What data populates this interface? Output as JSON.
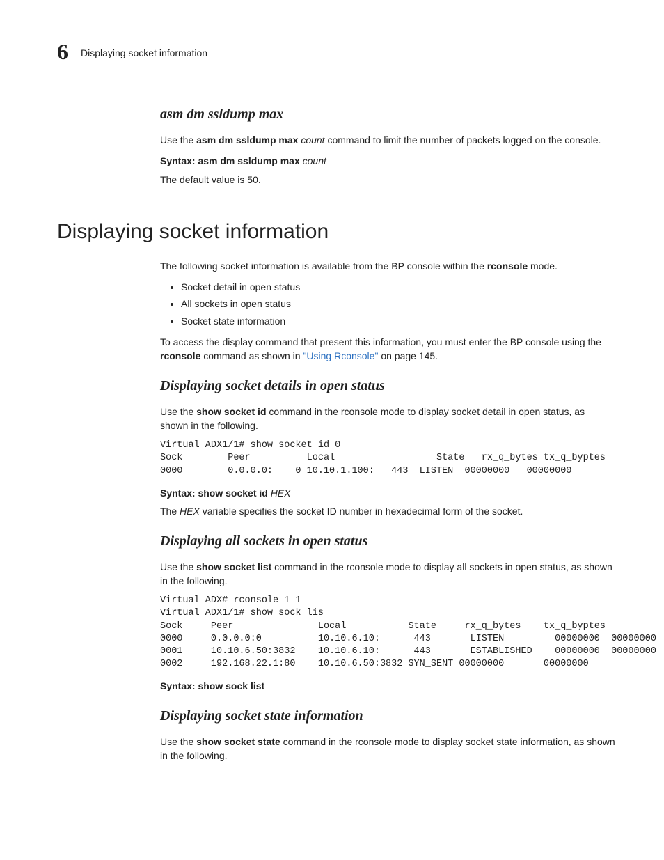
{
  "running_head": {
    "chapter_number": "6",
    "chapter_title": "Displaying socket information"
  },
  "sec_ssldump": {
    "heading": "asm dm ssldump max",
    "p1_a": "Use the ",
    "p1_cmd": "asm dm ssldump max",
    "p1_b": " ",
    "p1_arg": "count",
    "p1_c": " command to limit the number of packets logged on the console.",
    "syntax_label": "Syntax:",
    "syntax_cmd": "asm dm ssldump max",
    "syntax_arg": "count",
    "p2": "The default value is 50."
  },
  "h_main": "Displaying socket information",
  "sec_intro": {
    "p1_a": "The following socket information is available from the BP console within the ",
    "p1_b": "rconsole",
    "p1_c": " mode.",
    "bullets": [
      "Socket detail in open status",
      "All sockets in open status",
      "Socket state information"
    ],
    "p2_a": "To access the display command that present this information, you must enter the BP console using the ",
    "p2_b": "rconsole",
    "p2_c": " command as shown in ",
    "p2_link": "\"Using Rconsole\"",
    "p2_d": " on page 145."
  },
  "sec_detail": {
    "heading": "Displaying socket details in open status",
    "p1_a": "Use the ",
    "p1_cmd": "show socket id",
    "p1_b": " command in the rconsole mode to display socket detail in open status, as shown in the following.",
    "code": "Virtual ADX1/1# show socket id 0\nSock        Peer          Local                  State   rx_q_bytes tx_q_byptes\n0000        0.0.0.0:    0 10.10.1.100:   443  LISTEN  00000000   00000000",
    "syntax_label": "Syntax:",
    "syntax_cmd": "show socket id",
    "syntax_arg": "HEX",
    "p2_a": "The ",
    "p2_var": "HEX",
    "p2_b": " variable specifies the socket ID number in hexadecimal form of the socket."
  },
  "sec_list": {
    "heading": "Displaying all sockets in open status",
    "p1_a": "Use the ",
    "p1_cmd": "show socket list",
    "p1_b": " command in the rconsole mode to display all sockets in open status, as shown in the following.",
    "code": "Virtual ADX# rconsole 1 1\nVirtual ADX1/1# show sock lis\nSock     Peer               Local           State     rx_q_bytes    tx_q_byptes\n0000     0.0.0.0:0          10.10.6.10:      443       LISTEN         00000000  00000000\n0001     10.10.6.50:3832    10.10.6.10:      443       ESTABLISHED    00000000  00000000\n0002     192.168.22.1:80    10.10.6.50:3832 SYN_SENT 00000000       00000000",
    "syntax_label": "Syntax:",
    "syntax_cmd": "show sock list"
  },
  "sec_state": {
    "heading": "Displaying socket state information",
    "p1_a": "Use the ",
    "p1_cmd": "show socket state",
    "p1_b": " command in the rconsole mode to display socket state information, as shown in the following."
  }
}
